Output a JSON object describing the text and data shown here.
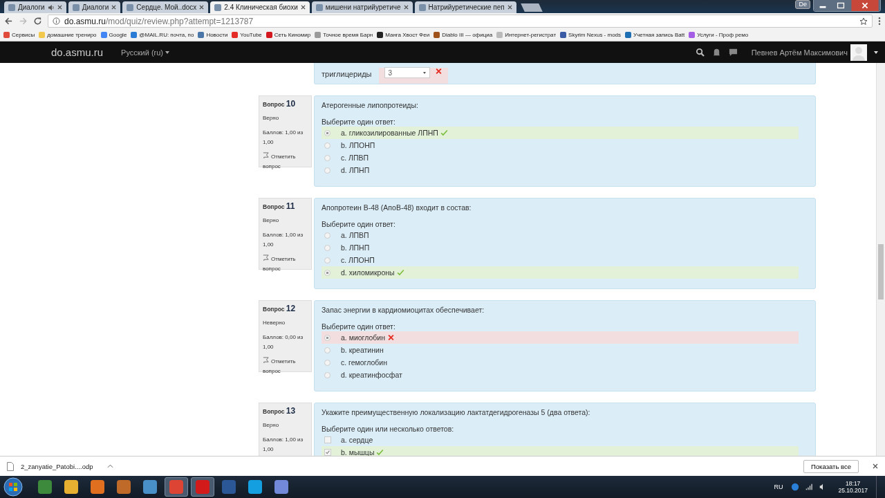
{
  "tabs": [
    {
      "title": "Диалоги",
      "selected": false,
      "audio": true
    },
    {
      "title": "Диалоги",
      "selected": false,
      "audio": false
    },
    {
      "title": "Сердце. Мой..docx",
      "selected": false,
      "audio": false
    },
    {
      "title": "2.4 Клиническая биохи",
      "selected": true,
      "audio": false
    },
    {
      "title": "мишени натрийуретиче",
      "selected": false,
      "audio": false
    },
    {
      "title": "Натрийуретические пеп",
      "selected": false,
      "audio": false
    }
  ],
  "window_buttons": {
    "language": "De"
  },
  "address_bar": {
    "host": "do.asmu.ru",
    "path": "/mod/quiz/review.php?attempt=1213787"
  },
  "bookmarks": [
    {
      "label": "Сервисы",
      "color": "#e04a3a"
    },
    {
      "label": "домашние трениро",
      "color": "#f2c94c"
    },
    {
      "label": "Google",
      "color": "#4285f4"
    },
    {
      "label": "@MAIL.RU: почта, по",
      "color": "#2a7bd6"
    },
    {
      "label": "Новости",
      "color": "#4a76a8"
    },
    {
      "label": "YouTube",
      "color": "#e52d27"
    },
    {
      "label": "Сеть Киномир",
      "color": "#d4181f"
    },
    {
      "label": "Точное время Барн",
      "color": "#9a9a9a"
    },
    {
      "label": "Манга Хвост Феи",
      "color": "#222222"
    },
    {
      "label": "Diablo III — официа",
      "color": "#a0521d"
    },
    {
      "label": "Интернет-регистрат",
      "color": "#bbbbbb"
    },
    {
      "label": "Skyrim Nexus - mods",
      "color": "#3b5ba5"
    },
    {
      "label": "Учетная запись Batt",
      "color": "#1f6fb5"
    },
    {
      "label": "Услуги - Проф ремо",
      "color": "#a45ee5"
    }
  ],
  "navbar": {
    "site": "do.asmu.ru",
    "language": "Русский (ru)",
    "user": "Певнев Артём Максимович"
  },
  "previous_question": {
    "label": "триглицериды",
    "value": "3",
    "correct": false
  },
  "questions": [
    {
      "label": "Вопрос",
      "number": "10",
      "status": "Верно",
      "score": "Баллов: 1,00 из 1,00",
      "flag": "Отметить вопрос",
      "prompt": "Атерогенные липопротеиды:",
      "instruction": "Выберите один ответ:",
      "kind": "radio",
      "options": [
        {
          "text": "a. гликозилированные ЛПНП",
          "selected": true,
          "correct": true
        },
        {
          "text": "b. ЛПОНП",
          "selected": false
        },
        {
          "text": "c. ЛПВП",
          "selected": false
        },
        {
          "text": "d. ЛПНП",
          "selected": false
        }
      ]
    },
    {
      "label": "Вопрос",
      "number": "11",
      "status": "Верно",
      "score": "Баллов: 1,00 из 1,00",
      "flag": "Отметить вопрос",
      "prompt": "Апопротеин В-48 (АпоВ-48) входит в состав:",
      "instruction": "Выберите один ответ:",
      "kind": "radio",
      "options": [
        {
          "text": "a. ЛПВП",
          "selected": false
        },
        {
          "text": "b. ЛПНП",
          "selected": false
        },
        {
          "text": "c. ЛПОНП",
          "selected": false
        },
        {
          "text": "d. хиломикроны",
          "selected": true,
          "correct": true
        }
      ]
    },
    {
      "label": "Вопрос",
      "number": "12",
      "status": "Неверно",
      "score": "Баллов: 0,00 из 1,00",
      "flag": "Отметить вопрос",
      "prompt": "Запас энергии в кардиомиоцитах обеспечивает:",
      "instruction": "Выберите один ответ:",
      "kind": "radio",
      "options": [
        {
          "text": "a. миоглобин",
          "selected": true,
          "correct": false
        },
        {
          "text": "b. креатинин",
          "selected": false
        },
        {
          "text": "c. гемоглобин",
          "selected": false
        },
        {
          "text": "d. креатинфосфат",
          "selected": false
        }
      ]
    },
    {
      "label": "Вопрос",
      "number": "13",
      "status": "Верно",
      "score": "Баллов: 1,00 из 1,00",
      "prompt": "Укажите преимущественную локализацию лактатдегидрогеназы 5 (два ответа):",
      "instruction": "Выберите один или несколько ответов:",
      "kind": "checkbox",
      "options": [
        {
          "text": "a. сердце",
          "selected": false
        },
        {
          "text": "b. мышцы",
          "selected": true,
          "correct": true
        }
      ]
    }
  ],
  "download": {
    "file": "2_zanyatie_Patobi....odp",
    "show_all": "Показать все"
  },
  "taskbar": {
    "language": "RU",
    "time": "18:17",
    "date": "25.10.2017"
  }
}
